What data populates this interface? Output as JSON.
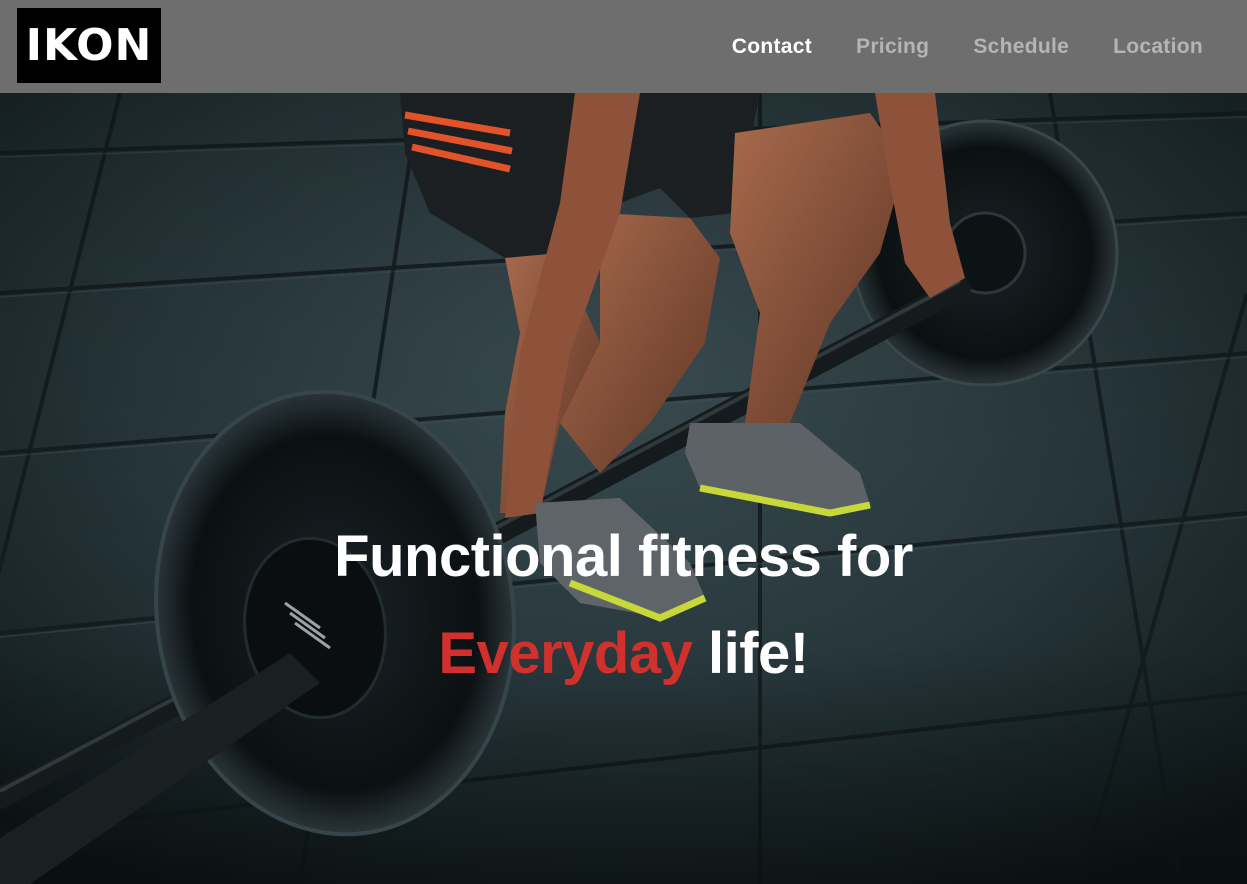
{
  "logo": {
    "text": "IKON"
  },
  "nav": {
    "items": [
      {
        "label": "Contact",
        "active": true
      },
      {
        "label": "Pricing",
        "active": false
      },
      {
        "label": "Schedule",
        "active": false
      },
      {
        "label": "Location",
        "active": false
      }
    ]
  },
  "hero": {
    "line1": "Functional fitness for",
    "accent_word": "Everyday",
    "line2_rest": "life!",
    "accent_color": "#d0312d"
  },
  "colors": {
    "navbar": "#6e6e6e",
    "logo_bg": "#000000",
    "nav_active": "#ffffff",
    "nav_inactive": "#b5b5b5"
  }
}
